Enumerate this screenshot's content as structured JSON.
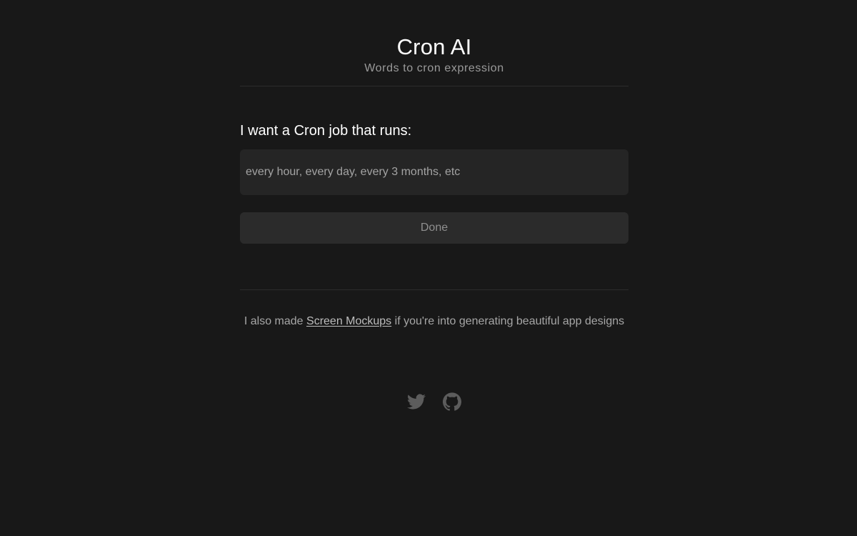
{
  "header": {
    "title": "Cron AI",
    "subtitle": "Words to cron expression"
  },
  "form": {
    "label": "I want a Cron job that runs:",
    "input_placeholder": "every hour, every day, every 3 months, etc",
    "input_value": "",
    "done_label": "Done"
  },
  "promo": {
    "prefix": "I also made ",
    "link_text": "Screen Mockups",
    "suffix": " if you're into generating beautiful app designs"
  },
  "social": {
    "icons": [
      "twitter-icon",
      "github-icon"
    ]
  },
  "colors": {
    "background": "#181818",
    "input_background": "#252525",
    "button_background": "#2b2b2b",
    "icon_color": "#5c5c5c"
  }
}
